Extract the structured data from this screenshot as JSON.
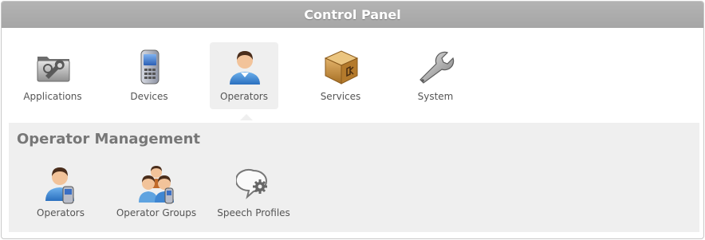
{
  "window": {
    "title": "Control Panel"
  },
  "nav": {
    "items": [
      {
        "label": "Applications",
        "icon": "applications-icon"
      },
      {
        "label": "Devices",
        "icon": "phone-device-icon"
      },
      {
        "label": "Operators",
        "icon": "operator-user-icon",
        "active": true
      },
      {
        "label": "Services",
        "icon": "package-box-icon"
      },
      {
        "label": "System",
        "icon": "wrench-icon"
      }
    ]
  },
  "section": {
    "title": "Operator Management",
    "items": [
      {
        "label": "Operators",
        "icon": "operator-device-icon"
      },
      {
        "label": "Operator Groups",
        "icon": "operator-groups-icon"
      },
      {
        "label": "Speech Profiles",
        "icon": "speech-gear-icon"
      }
    ]
  },
  "colors": {
    "titlebar": "#a6a6a6",
    "active_item_bg": "#efefef",
    "subpanel_bg": "#efefef",
    "label_text": "#555555",
    "subtitle_text": "#777777"
  }
}
